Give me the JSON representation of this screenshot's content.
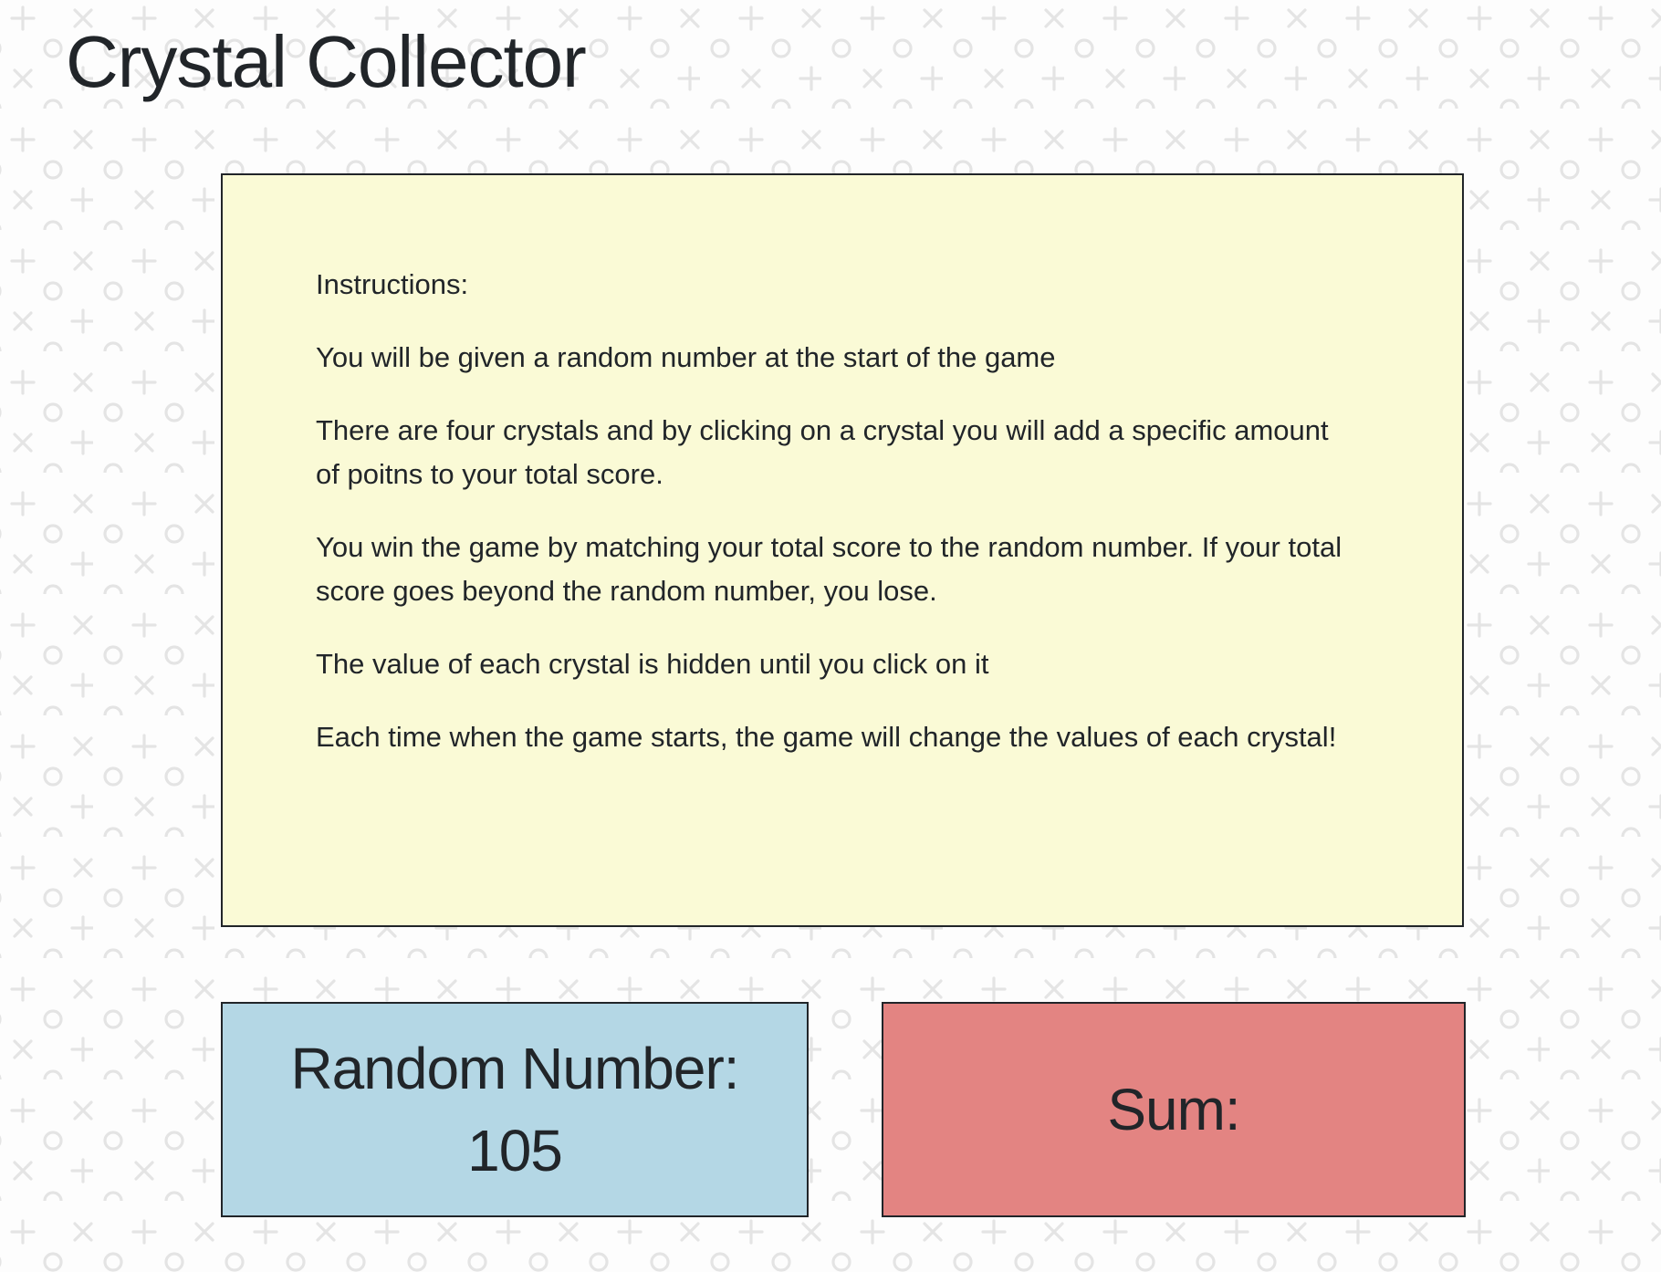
{
  "page": {
    "title": "Crystal Collector"
  },
  "instructions": {
    "lines": [
      "Instructions:",
      "You will be given a random number at the start of the game",
      "There are four crystals and by clicking on a crystal you will add a specific amount of poitns to your total score.",
      "You win the game by matching your total score to the random number. If your total score goes beyond the random number, you lose.",
      "The value of each crystal is hidden until you click on it",
      "Each time when the game starts, the game will change the values of each crystal!"
    ]
  },
  "random_number": {
    "label": "Random Number:",
    "value": "105"
  },
  "sum": {
    "label": "Sum:",
    "value": ""
  },
  "colors": {
    "instructions_bg": "#fafad6",
    "random_bg": "#b4d7e5",
    "sum_bg": "#e38482",
    "text": "#212529",
    "pattern": "#e4e4e4"
  },
  "icons": {
    "background_pattern": "x-o-plus-pattern"
  }
}
